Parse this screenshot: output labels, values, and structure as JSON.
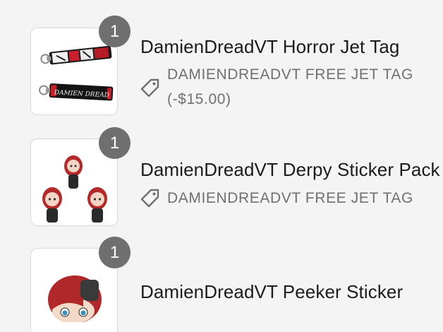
{
  "items": [
    {
      "quantity": "1",
      "title": "DamienDreadVT Horror Jet Tag",
      "discount": "DAMIENDREADVT FREE JET TAG (-$15.00)",
      "image_icon": "jet-tag-keychain-image"
    },
    {
      "quantity": "1",
      "title": "DamienDreadVT Derpy Sticker Pack",
      "discount": "DAMIENDREADVT FREE JET TAG",
      "image_icon": "sticker-pack-image"
    },
    {
      "quantity": "1",
      "title": "DamienDreadVT Peeker Sticker",
      "image_icon": "peeker-sticker-image"
    }
  ],
  "colors": {
    "background": "#f4f4f4",
    "badge": "#6f6f6f",
    "muted_text": "#707070"
  }
}
